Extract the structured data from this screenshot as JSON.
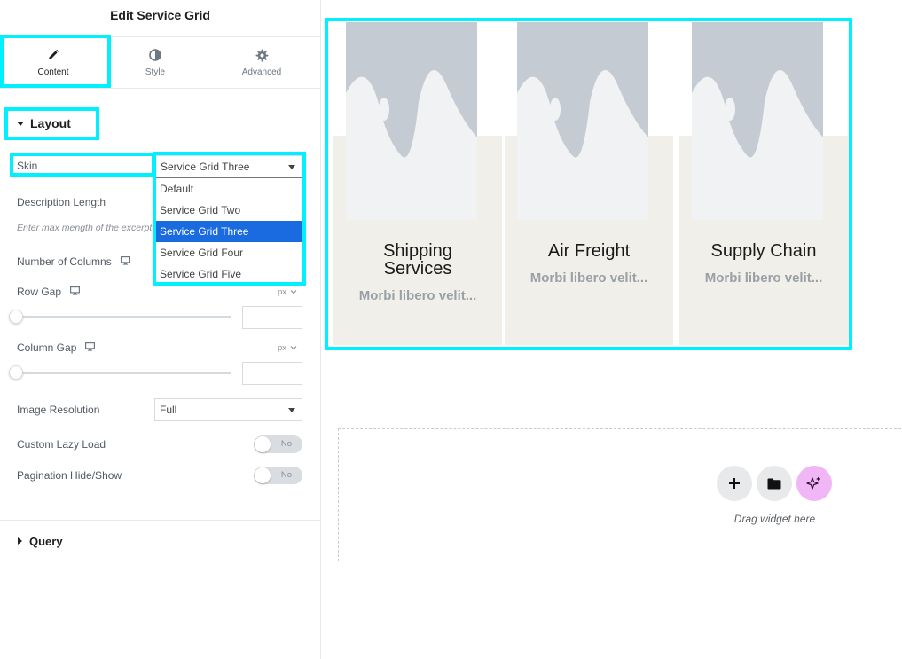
{
  "panel": {
    "title": "Edit Service Grid",
    "tabs": [
      {
        "label": "Content",
        "icon": "pencil-icon"
      },
      {
        "label": "Style",
        "icon": "half-circle-icon"
      },
      {
        "label": "Advanced",
        "icon": "gear-icon"
      }
    ],
    "layout_section": "Layout",
    "skin": {
      "label": "Skin",
      "value": "Service Grid Three",
      "options": [
        "Default",
        "Service Grid Two",
        "Service Grid Three",
        "Service Grid Four",
        "Service Grid Five"
      ]
    },
    "description_length": {
      "label": "Description Length",
      "hint": "Enter max mength of the excerpt"
    },
    "number_of_columns": {
      "label": "Number of Columns"
    },
    "row_gap": {
      "label": "Row Gap",
      "unit": "px"
    },
    "column_gap": {
      "label": "Column Gap",
      "unit": "px"
    },
    "image_resolution": {
      "label": "Image Resolution",
      "value": "Full"
    },
    "custom_lazy_load": {
      "label": "Custom Lazy Load",
      "toggle": "No"
    },
    "pagination": {
      "label": "Pagination Hide/Show",
      "toggle": "No"
    },
    "query_section": "Query"
  },
  "preview": {
    "cards": [
      {
        "title_line1": "Shipping",
        "title_line2": "Services",
        "desc": "Morbi libero velit..."
      },
      {
        "title_line1": "Air Freight",
        "desc": "Morbi libero velit..."
      },
      {
        "title_line1": "Supply Chain",
        "desc": "Morbi libero velit..."
      }
    ],
    "drag_text": "Drag widget here"
  },
  "colors": {
    "highlight": "#00f0ff",
    "selected_option": "#1a6be0",
    "ai_button": "#f1b6f5",
    "card_background": "#f1efe9",
    "placeholder_grey": "#c5cbd2"
  }
}
